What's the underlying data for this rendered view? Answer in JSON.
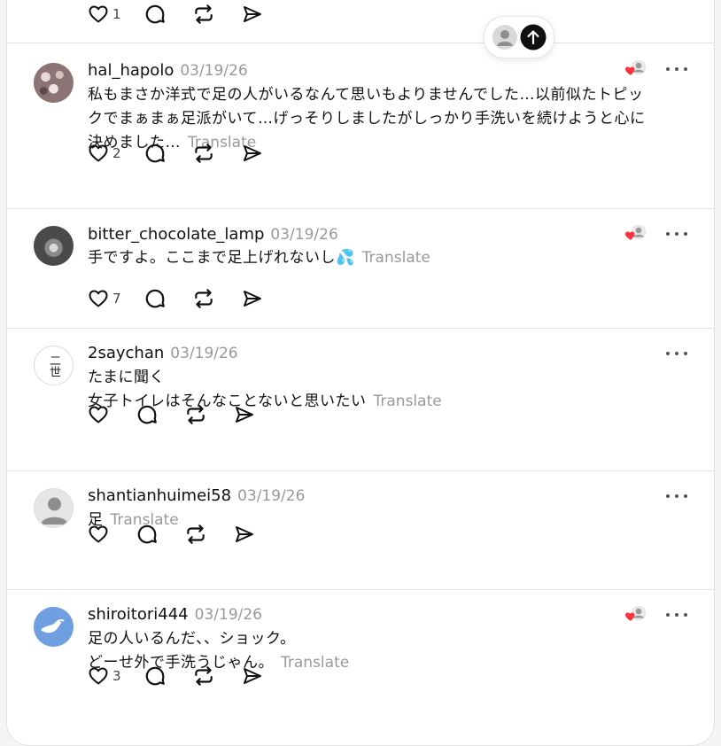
{
  "translate_label": "Translate",
  "top_post": {
    "like_count": "1"
  },
  "posts": [
    {
      "username": "hal_hapolo",
      "date": "03/19/26",
      "lines": [
        "私もまさか洋式で足の人がいるなんて思いもよりませんでした…以前似たトピッ",
        "クでまぁまぁ足派がいて…げっそりしましたがしっかり手洗いを続けようと心に",
        "決めました…"
      ],
      "like_count": "2",
      "liked_badge": true,
      "avatar": "photo-flowers"
    },
    {
      "username": "bitter_chocolate_lamp",
      "date": "03/19/26",
      "lines": [
        "手ですよ。ここまで足上げれないし💦"
      ],
      "like_count": "7",
      "liked_badge": true,
      "avatar": "photo-lamp"
    },
    {
      "username": "2saychan",
      "date": "03/19/26",
      "lines": [
        "たまに聞く",
        "女子トイレはそんなことないと思いたい"
      ],
      "like_count": "",
      "liked_badge": false,
      "avatar": "kanji",
      "avatar_text": "二世"
    },
    {
      "username": "shantianhuimei58",
      "date": "03/19/26",
      "lines": [
        "足"
      ],
      "like_count": "",
      "liked_badge": false,
      "avatar": "default-person"
    },
    {
      "username": "shiroitori444",
      "date": "03/19/26",
      "lines": [
        "足の人いるんだ、、ショック。",
        "どーせ外で手洗うじゃん。"
      ],
      "like_count": "3",
      "liked_badge": true,
      "avatar": "bird"
    }
  ],
  "colors": {
    "accent_red": "#ff3040",
    "text": "#101010",
    "muted": "#999999",
    "divider": "#e0e0e0"
  },
  "icons": [
    "heart-icon",
    "comment-icon",
    "repost-icon",
    "share-icon",
    "more-icon",
    "arrow-up-icon",
    "person-icon"
  ]
}
